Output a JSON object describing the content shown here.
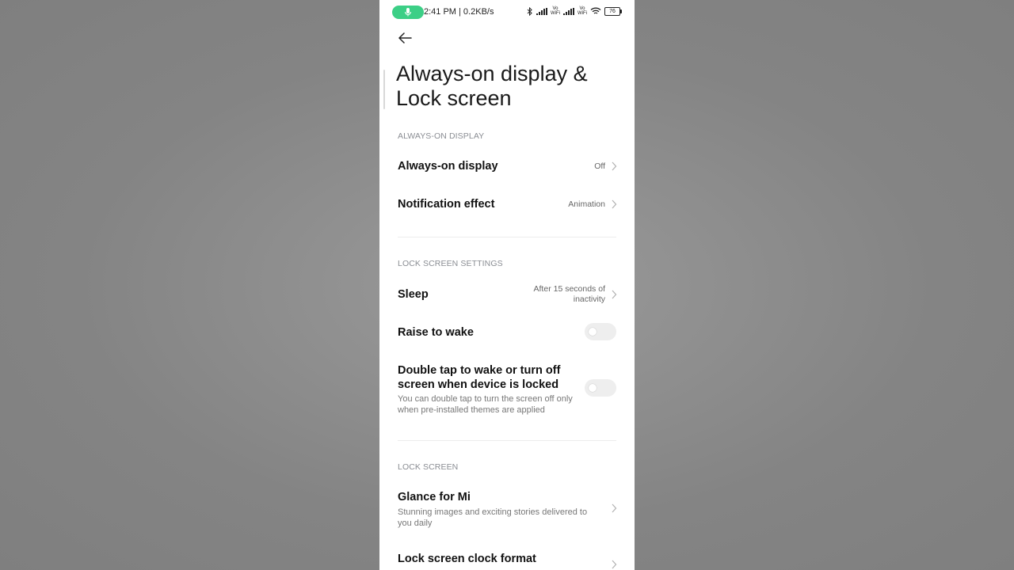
{
  "status_bar": {
    "time_and_speed": "2:41 PM | 0.2KB/s",
    "volte_1": "Vo\nWiFi",
    "volte_2": "Vo\nWiFi",
    "battery": "76",
    "mic_color": "#3ccf86"
  },
  "page": {
    "title_line1": "Always-on display &",
    "title_line2": "Lock screen"
  },
  "sections": {
    "aod": {
      "header": "ALWAYS-ON DISPLAY",
      "always_on": {
        "title": "Always-on display",
        "value": "Off"
      },
      "notification_effect": {
        "title": "Notification effect",
        "value": "Animation"
      }
    },
    "lock_settings": {
      "header": "LOCK SCREEN SETTINGS",
      "sleep": {
        "title": "Sleep",
        "value_line1": "After 15 seconds of",
        "value_line2": "inactivity"
      },
      "raise_to_wake": {
        "title": "Raise to wake",
        "enabled": false
      },
      "double_tap": {
        "title_line1": "Double tap to wake or turn off",
        "title_line2": "screen when device is locked",
        "sub_line1": "You can double tap to turn the screen off only",
        "sub_line2": "when pre-installed themes are applied",
        "enabled": false
      }
    },
    "lock_screen": {
      "header": "LOCK SCREEN",
      "glance": {
        "title": "Glance for Mi",
        "sub_line1": "Stunning images and exciting stories delivered to",
        "sub_line2": "you daily"
      },
      "clock_format": {
        "title": "Lock screen clock format"
      }
    }
  }
}
